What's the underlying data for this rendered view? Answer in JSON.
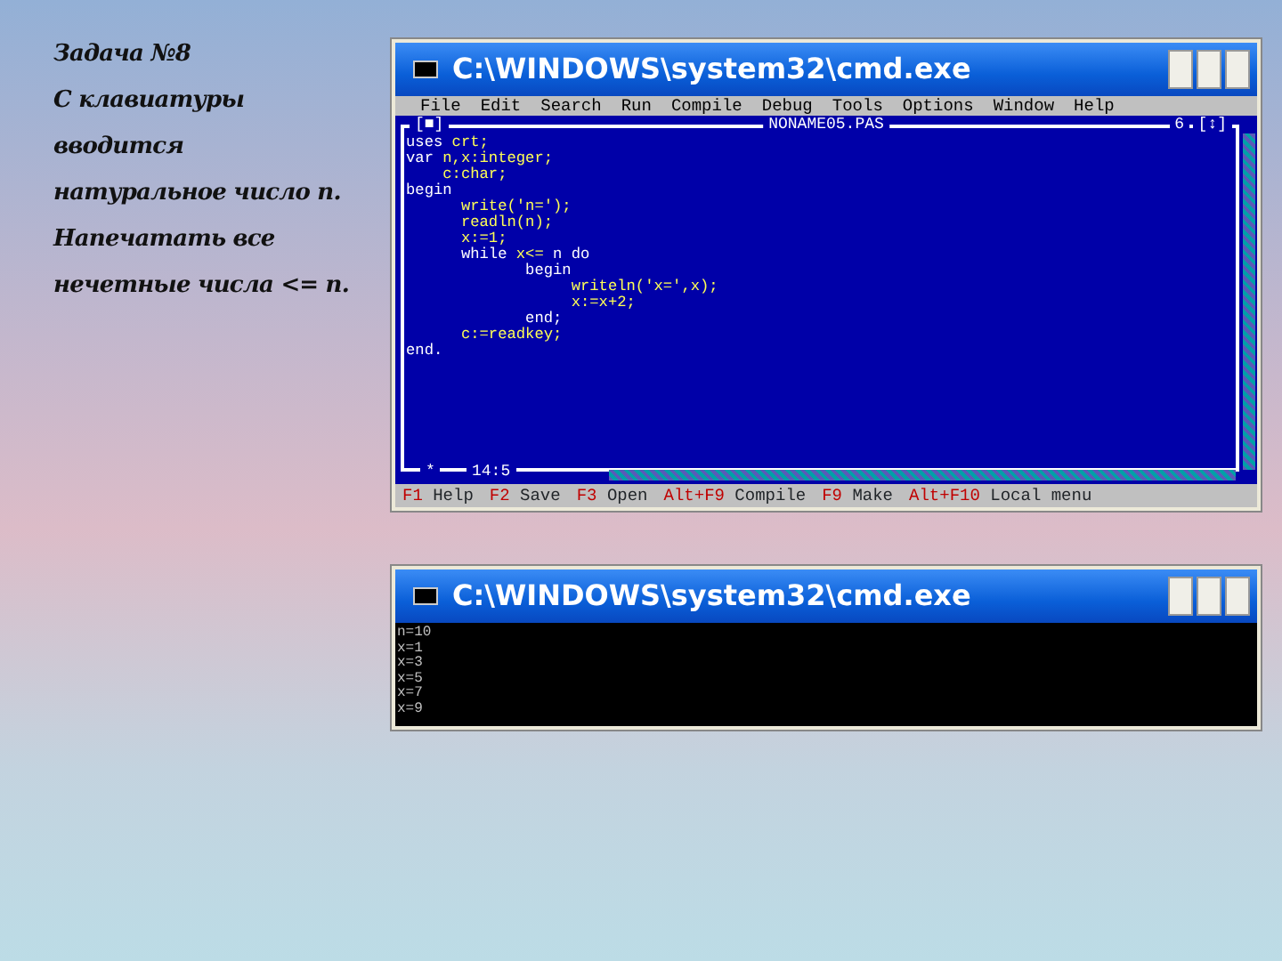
{
  "slide_text": {
    "lines": [
      "Задача №8",
      "С клавиатуры",
      "вводится",
      "натуральное число n.",
      "Напечатать все",
      "нечетные числа <= n."
    ]
  },
  "editor_window": {
    "title": "C:\\WINDOWS\\system32\\cmd.exe",
    "menu": [
      {
        "hotkey": "F",
        "rest": "ile"
      },
      {
        "hotkey": "E",
        "rest": "dit"
      },
      {
        "hotkey": "S",
        "rest": "earch"
      },
      {
        "hotkey": "R",
        "rest": "un"
      },
      {
        "hotkey": "C",
        "rest": "ompile"
      },
      {
        "hotkey": "D",
        "rest": "ebug"
      },
      {
        "hotkey": "T",
        "rest": "ools"
      },
      {
        "hotkey": "O",
        "rest": "ptions"
      },
      {
        "hotkey": "W",
        "rest": "indow"
      },
      {
        "hotkey": "H",
        "rest": "elp"
      }
    ],
    "close_box": "[■]",
    "file_name": "NONAME05.PAS",
    "window_number": "6",
    "zoom_box": "[↕]",
    "modified_mark": "*",
    "cursor_position": "14:5",
    "code": [
      [
        {
          "kind": "keyword",
          "text": "uses "
        },
        {
          "kind": "ident",
          "text": "crt;"
        }
      ],
      [
        {
          "kind": "keyword",
          "text": "var "
        },
        {
          "kind": "ident",
          "text": "n,x:integer;"
        }
      ],
      [
        {
          "kind": "ident",
          "text": "    c:char;"
        }
      ],
      [
        {
          "kind": "keyword",
          "text": "begin"
        }
      ],
      [
        {
          "kind": "ident",
          "text": "      write('n=');"
        }
      ],
      [
        {
          "kind": "ident",
          "text": "      readln(n);"
        }
      ],
      [
        {
          "kind": "ident",
          "text": "      x:=1;"
        }
      ],
      [
        {
          "kind": "keyword",
          "text": "      while "
        },
        {
          "kind": "ident",
          "text": "x<= "
        },
        {
          "kind": "keyword",
          "text": "n do"
        }
      ],
      [
        {
          "kind": "keyword",
          "text": "             begin"
        }
      ],
      [
        {
          "kind": "ident",
          "text": "                  writeln('x=',x);"
        }
      ],
      [
        {
          "kind": "ident",
          "text": "                  x:=x+2;"
        }
      ],
      [
        {
          "kind": "keyword",
          "text": "             end;"
        }
      ],
      [
        {
          "kind": "ident",
          "text": "      c:=readkey;"
        }
      ],
      [
        {
          "kind": "keyword",
          "text": "end."
        }
      ]
    ],
    "status_bar": [
      {
        "key": "F1",
        "label": "Help"
      },
      {
        "key": "F2",
        "label": "Save"
      },
      {
        "key": "F3",
        "label": "Open"
      },
      {
        "key": "Alt+F9",
        "label": "Compile"
      },
      {
        "key": "F9",
        "label": "Make"
      },
      {
        "key": "Alt+F10",
        "label": "Local menu"
      }
    ]
  },
  "output_window": {
    "title": "C:\\WINDOWS\\system32\\cmd.exe",
    "lines": [
      "n=10",
      "x=1",
      "x=3",
      "x=5",
      "x=7",
      "x=9"
    ]
  }
}
